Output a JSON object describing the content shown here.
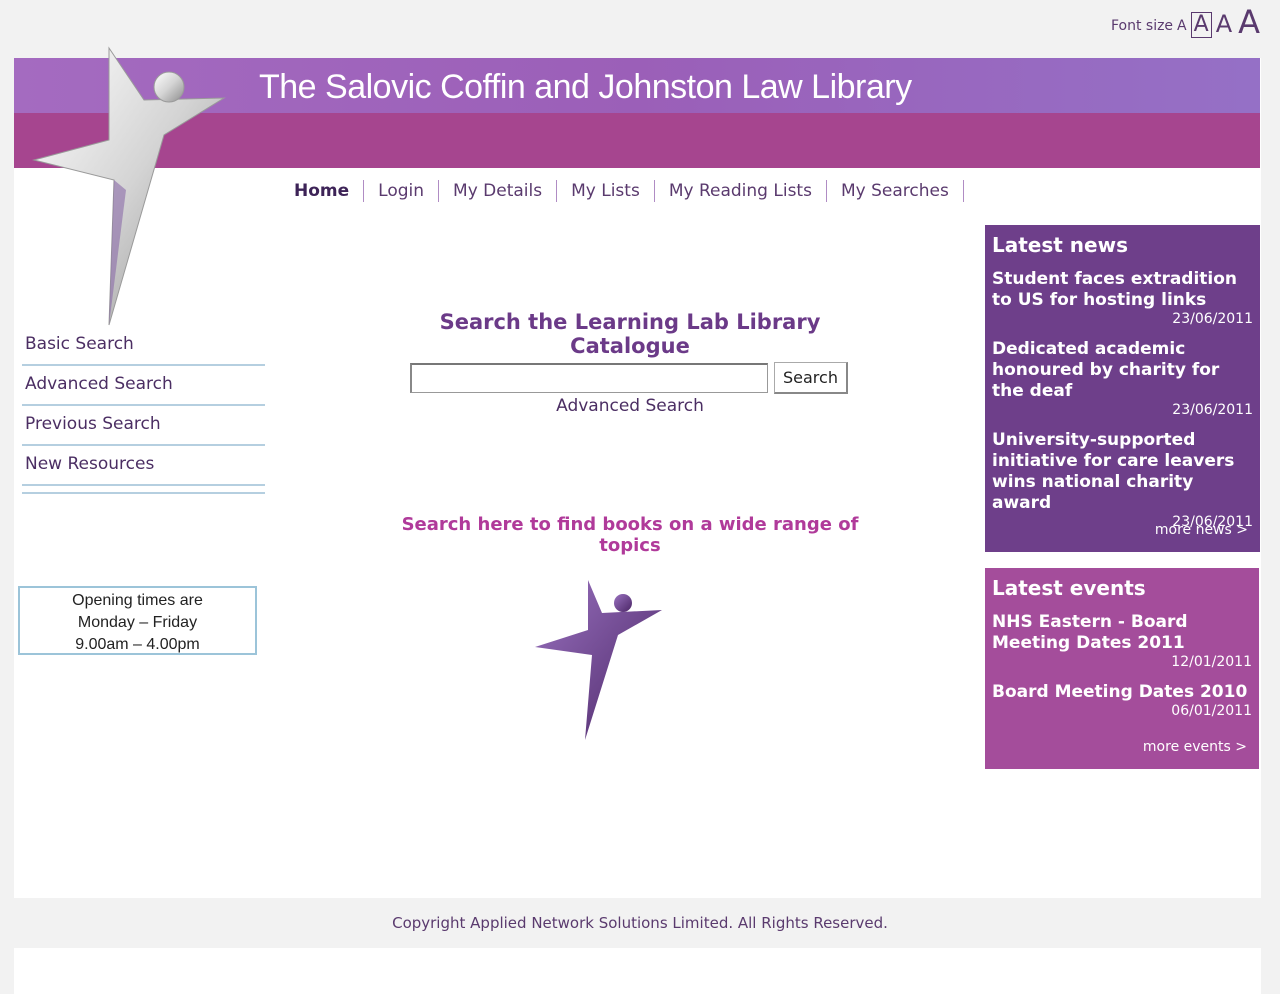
{
  "font_size": {
    "label": "Font size",
    "options": [
      "A",
      "A",
      "A",
      "A"
    ]
  },
  "header": {
    "title": "The Salovic Coffin and Johnston Law Library"
  },
  "nav": {
    "items": [
      "Home",
      "Login",
      "My Details",
      "My Lists",
      "My Reading Lists",
      "My Searches"
    ],
    "active": "Home"
  },
  "sidebar": {
    "items": [
      "Basic Search",
      "Advanced Search",
      "Previous Search",
      "New Resources"
    ],
    "opening": [
      "Opening times are",
      "Monday – Friday",
      "9.00am – 4.00pm"
    ]
  },
  "search": {
    "heading": "Search the Learning Lab Library Catalogue",
    "value": "",
    "placeholder": "",
    "button_label": "Search",
    "advanced_link": "Advanced Search",
    "tagline": "Search here to find books on a wide range of topics"
  },
  "news": {
    "title": "Latest news",
    "items": [
      {
        "title": "Student faces extradition to US for hosting links",
        "date": "23/06/2011"
      },
      {
        "title": "Dedicated academic honoured by charity for the deaf",
        "date": "23/06/2011"
      },
      {
        "title": "University-supported initiative for care leavers wins national charity award",
        "date": "23/06/2011"
      }
    ],
    "more": "more news >"
  },
  "events": {
    "title": "Latest events",
    "items": [
      {
        "title": "NHS Eastern - Board Meeting Dates 2011",
        "date": "12/01/2011"
      },
      {
        "title": "Board Meeting Dates 2010",
        "date": "06/01/2011"
      }
    ],
    "more": "more events >"
  },
  "footer": {
    "text": "Copyright Applied Network Solutions Limited. All Rights Reserved."
  },
  "colors": {
    "banner_top": "#9b5fb8",
    "banner_bottom": "#a6458f",
    "news_bg": "#6e3f8a",
    "events_bg": "#a44d9b",
    "accent": "#6b3a88"
  }
}
